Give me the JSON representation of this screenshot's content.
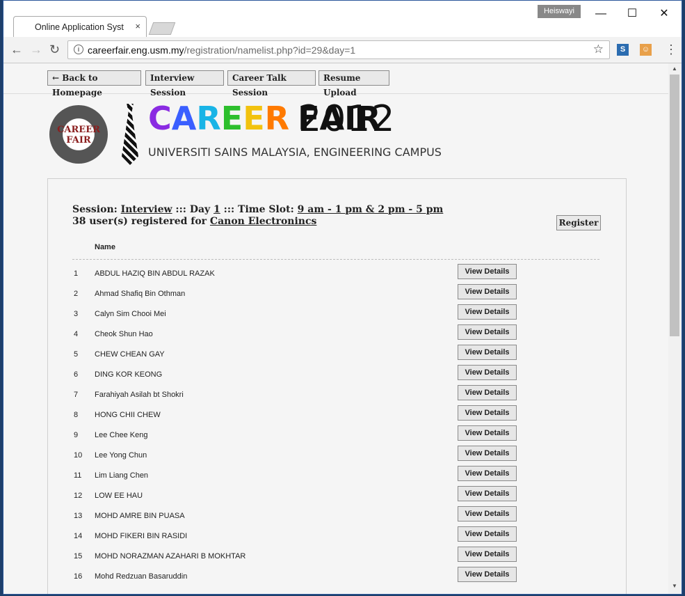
{
  "browser": {
    "tab_title": "Online Application System",
    "close_glyph": "×",
    "user_badge": "Heiswayi",
    "url_host": "careerfair.eng.usm.my",
    "url_path": "/registration/namelist.php?id=29&day=1",
    "icons": {
      "back": "←",
      "forward": "→",
      "reload": "↻",
      "info": "i",
      "star": "☆",
      "menu": "⋮",
      "minimize": "—",
      "maximize": "☐",
      "close": "✕"
    }
  },
  "nav": {
    "back": "← Back to Homepage",
    "interview": "Interview Session",
    "career_talk": "Career Talk Session",
    "resume": "Resume Upload"
  },
  "header": {
    "logo_text": "CAREER FAIR",
    "brand_letters": [
      "C",
      "A",
      "R",
      "E",
      "E",
      "R",
      " ",
      "F",
      "A",
      "I",
      "R"
    ],
    "brand_colors": [
      "#8a2be2",
      "#3a5fff",
      "#19b4e6",
      "#2dbf2d",
      "#f2c20f",
      "#ff7a00",
      "#111",
      "#111",
      "#111",
      "#111",
      "#111"
    ],
    "year": "2012",
    "subtitle": "UNIVERSITI SAINS MALAYSIA, ENGINEERING CAMPUS"
  },
  "session": {
    "label": "Session: ",
    "type": "Interview",
    "sep1": " ::: Day ",
    "day": "1",
    "sep2": " ::: Time Slot: ",
    "time_slot": "9 am - 1 pm & 2 pm - 5 pm",
    "count_text": "38 user(s) registered for ",
    "company": "Canon Electronincs"
  },
  "register_label": "Register",
  "table": {
    "name_header": "Name",
    "button_label": "View Details",
    "rows": [
      {
        "num": "1",
        "name": "ABDUL HAZIQ BIN ABDUL RAZAK"
      },
      {
        "num": "2",
        "name": "Ahmad Shafiq Bin Othman"
      },
      {
        "num": "3",
        "name": "Calyn Sim Chooi Mei"
      },
      {
        "num": "4",
        "name": "Cheok Shun Hao"
      },
      {
        "num": "5",
        "name": "CHEW CHEAN GAY"
      },
      {
        "num": "6",
        "name": "DING KOR KEONG"
      },
      {
        "num": "7",
        "name": "Farahiyah Asilah bt Shokri"
      },
      {
        "num": "8",
        "name": "HONG CHII CHEW"
      },
      {
        "num": "9",
        "name": "Lee Chee Keng"
      },
      {
        "num": "10",
        "name": "Lee Yong Chun"
      },
      {
        "num": "11",
        "name": "Lim Liang Chen"
      },
      {
        "num": "12",
        "name": "LOW EE HAU"
      },
      {
        "num": "13",
        "name": "MOHD AMRE BIN PUASA"
      },
      {
        "num": "14",
        "name": "MOHD FIKERI BIN RASIDI"
      },
      {
        "num": "15",
        "name": "MOHD NORAZMAN AZAHARI B MOKHTAR"
      },
      {
        "num": "16",
        "name": "Mohd Redzuan Basaruddin"
      }
    ]
  }
}
